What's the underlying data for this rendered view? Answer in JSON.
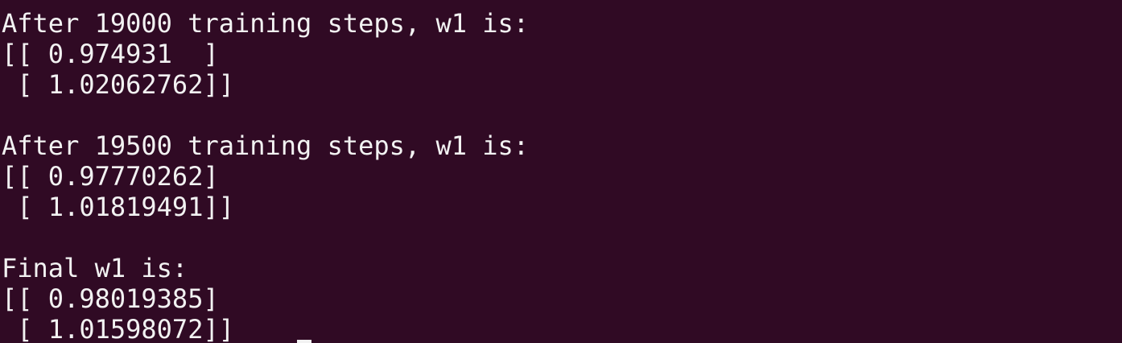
{
  "colors": {
    "background": "#300a24",
    "text": "#f2f2f2"
  },
  "terminal": {
    "blocks": [
      {
        "header": "After 19000 training steps, w1 is:",
        "row1": "[[ 0.974931  ]",
        "row2": " [ 1.02062762]]"
      },
      {
        "header": "After 19500 training steps, w1 is:",
        "row1": "[[ 0.97770262]",
        "row2": " [ 1.01819491]]"
      },
      {
        "header": "Final w1 is:",
        "row1": "[[ 0.98019385]",
        "row2": " [ 1.01598072]]"
      }
    ]
  }
}
